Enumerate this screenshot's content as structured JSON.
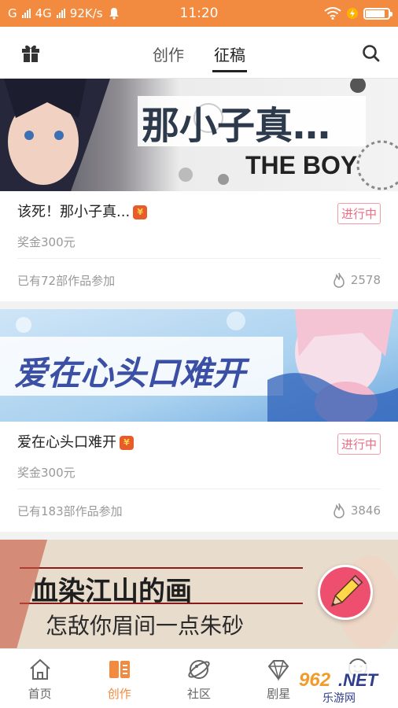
{
  "status_bar": {
    "carrier": "G",
    "network": "4G",
    "speed": "92K/s",
    "time": "11:20",
    "battery_level": 0.85
  },
  "header": {
    "tabs": [
      {
        "label": "创作",
        "active": false
      },
      {
        "label": "征稿",
        "active": true
      }
    ]
  },
  "cards": [
    {
      "banner_title": "那小子真…",
      "banner_subtitle": "THE BOY",
      "title": "该死！那小子真...",
      "status": "进行中",
      "prize": "奖金300元",
      "participants": "已有72部作品参加",
      "heat": "2578"
    },
    {
      "banner_title": "爱在心头口难开",
      "title": "爱在心头口难开",
      "status": "进行中",
      "prize": "奖金300元",
      "participants": "已有183部作品参加",
      "heat": "3846"
    },
    {
      "banner_title": "血染江山的画",
      "banner_subtitle": "怎敌你眉间一点朱砂"
    }
  ],
  "bottom_nav": [
    {
      "label": "首页",
      "icon": "home-icon",
      "active": false
    },
    {
      "label": "创作",
      "icon": "book-icon",
      "active": true
    },
    {
      "label": "社区",
      "icon": "planet-icon",
      "active": false
    },
    {
      "label": "剧星",
      "icon": "diamond-icon",
      "active": false
    },
    {
      "label": "",
      "icon": "face-icon",
      "active": false
    }
  ],
  "watermark": {
    "text": "962.NET",
    "subtext": "乐游网"
  },
  "colors": {
    "accent": "#f28a3f",
    "status_pink": "#ee6d83",
    "fab": "#ef4f6f"
  }
}
